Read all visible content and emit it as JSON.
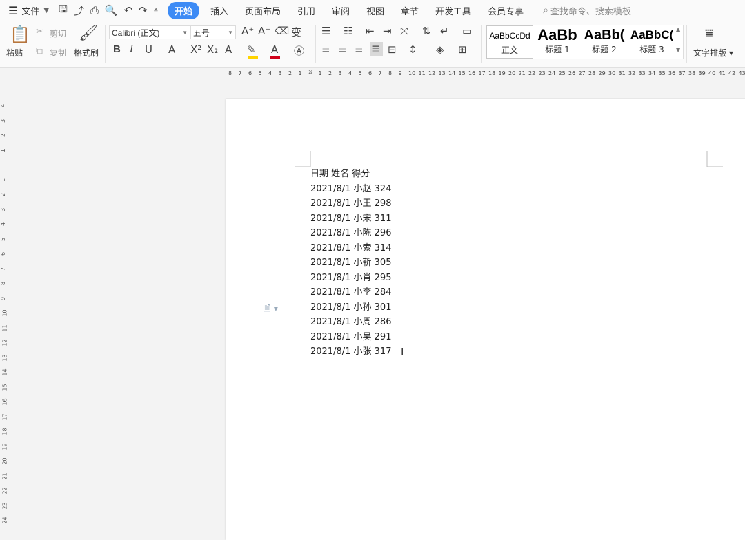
{
  "menubar": {
    "file_label": "文件",
    "tabs": [
      {
        "label": "开始",
        "active": true
      },
      {
        "label": "插入"
      },
      {
        "label": "页面布局"
      },
      {
        "label": "引用"
      },
      {
        "label": "审阅"
      },
      {
        "label": "视图"
      },
      {
        "label": "章节"
      },
      {
        "label": "开发工具"
      },
      {
        "label": "会员专享"
      }
    ],
    "search_placeholder": "查找命令、搜索模板"
  },
  "ribbon": {
    "paste": "粘贴",
    "cut": "剪切",
    "copy": "复制",
    "format_painter": "格式刷",
    "font_name": "Calibri (正文)",
    "font_size": "五号",
    "styles": [
      {
        "preview": "AaBbCcDd",
        "name": "正文"
      },
      {
        "preview": "AaBb",
        "name": "标题 1"
      },
      {
        "preview": "AaBb(",
        "name": "标题 2"
      },
      {
        "preview": "AaBbC(",
        "name": "标题 3"
      }
    ],
    "text_layout": "文字排版"
  },
  "ruler": {
    "h_left": [
      "8",
      "7",
      "6",
      "5",
      "4",
      "3",
      "2",
      "1"
    ],
    "h_right": [
      "1",
      "2",
      "3",
      "4",
      "5",
      "6",
      "7",
      "8",
      "9",
      "10",
      "11",
      "12",
      "13",
      "14",
      "15",
      "16",
      "17",
      "18",
      "19",
      "20",
      "21",
      "22",
      "23",
      "24",
      "25",
      "26",
      "27",
      "28",
      "29",
      "30",
      "31",
      "32",
      "33",
      "34",
      "35",
      "36",
      "37",
      "38",
      "39",
      "40",
      "41",
      "42",
      "43"
    ],
    "v_top": [
      "4",
      "3",
      "2",
      "1"
    ],
    "v_bottom": [
      "1",
      "2",
      "3",
      "4",
      "5",
      "6",
      "7",
      "8",
      "9",
      "10",
      "11",
      "12",
      "13",
      "14",
      "15",
      "16",
      "17",
      "18",
      "19",
      "20",
      "21",
      "22",
      "23",
      "24"
    ]
  },
  "document": {
    "lines": [
      "日期 姓名 得分",
      "2021/8/1 小赵 324",
      "2021/8/1 小王 298",
      "2021/8/1 小宋 311",
      "2021/8/1 小陈 296",
      "2021/8/1 小索 314",
      "2021/8/1 小靳 305",
      "2021/8/1 小肖 295",
      "2021/8/1 小李 284",
      "2021/8/1 小孙 301",
      "2021/8/1 小周 286",
      "2021/8/1 小吴 291",
      "2021/8/1 小张 317"
    ]
  },
  "colors": {
    "accent": "#3d8bf5",
    "font_color_bar": "#d0021b",
    "highlight_bar": "#ffd400"
  }
}
